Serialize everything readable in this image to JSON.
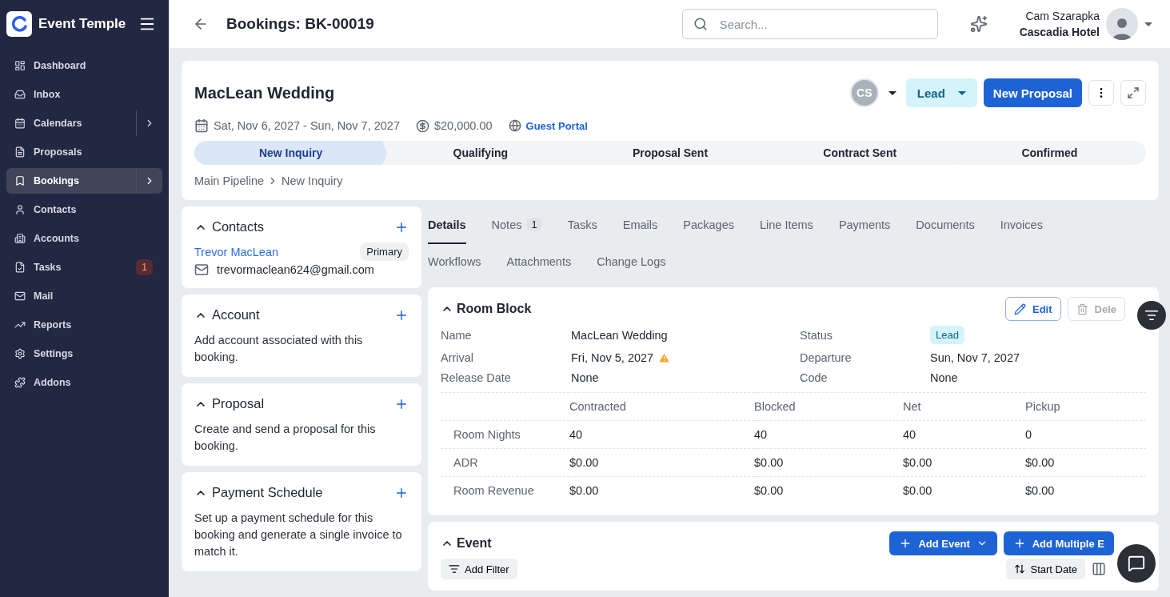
{
  "sidebar": {
    "brand": "Event Temple",
    "items": [
      {
        "label": "Dashboard",
        "selected": false
      },
      {
        "label": "Inbox",
        "selected": false
      },
      {
        "label": "Calendars",
        "selected": false,
        "submenu": true
      },
      {
        "label": "Proposals",
        "selected": false
      },
      {
        "label": "Bookings",
        "selected": true,
        "submenu": true
      },
      {
        "label": "Contacts",
        "selected": false
      },
      {
        "label": "Accounts",
        "selected": false
      },
      {
        "label": "Tasks",
        "selected": false,
        "badge": "1"
      },
      {
        "label": "Mail",
        "selected": false
      },
      {
        "label": "Reports",
        "selected": false
      },
      {
        "label": "Settings",
        "selected": false
      },
      {
        "label": "Addons",
        "selected": false
      }
    ]
  },
  "header": {
    "title": "Bookings: BK-00019",
    "search": {
      "placeholder": "Search..."
    },
    "user": {
      "name": "Cam Szarapka",
      "venue": "Cascadia Hotel"
    }
  },
  "booking": {
    "name": "MacLean Wedding",
    "owner_initials": "CS",
    "status": "Lead",
    "primary_action": "New Proposal",
    "dates": "Sat, Nov 6, 2027 - Sun, Nov 7, 2027",
    "amount": "$20,000.00",
    "portal_link": "Guest Portal",
    "stages": [
      {
        "label": "New Inquiry",
        "selected": true
      },
      {
        "label": "Qualifying",
        "selected": false
      },
      {
        "label": "Proposal Sent",
        "selected": false
      },
      {
        "label": "Contract Sent",
        "selected": false
      },
      {
        "label": "Confirmed",
        "selected": false
      }
    ],
    "breadcrumb": [
      "Main Pipeline",
      "New Inquiry"
    ]
  },
  "side_cards": [
    {
      "title": "Contacts",
      "contact": {
        "name": "Trevor MacLean",
        "role": "Primary",
        "email": "trevormaclean624@gmail.com"
      }
    },
    {
      "title": "Account",
      "text": "Add account associated with this booking."
    },
    {
      "title": "Proposal",
      "text": "Create and send a proposal for this booking."
    },
    {
      "title": "Payment Schedule",
      "text": "Set up a payment schedule for this booking and generate a single invoice to match it."
    }
  ],
  "tabs": [
    {
      "label": "Details",
      "selected": true
    },
    {
      "label": "Notes",
      "selected": false,
      "count": "1"
    },
    {
      "label": "Tasks",
      "selected": false
    },
    {
      "label": "Emails",
      "selected": false
    },
    {
      "label": "Packages",
      "selected": false
    },
    {
      "label": "Line Items",
      "selected": false
    },
    {
      "label": "Payments",
      "selected": false
    },
    {
      "label": "Documents",
      "selected": false
    },
    {
      "label": "Invoices",
      "selected": false
    },
    {
      "label": "Workflows",
      "selected": false
    },
    {
      "label": "Attachments",
      "selected": false
    },
    {
      "label": "Change Logs",
      "selected": false
    }
  ],
  "room_block": {
    "title": "Room Block",
    "edit": "Edit",
    "delete": "Dele",
    "fields": [
      {
        "label": "Name",
        "value": "MacLean Wedding"
      },
      {
        "label": "Status",
        "value": "Lead",
        "kind": "badge"
      },
      {
        "label": "Arrival",
        "value": "Fri, Nov 5, 2027",
        "kind": "warning"
      },
      {
        "label": "Departure",
        "value": "Sun, Nov 7, 2027"
      },
      {
        "label": "Release Date",
        "value": "None"
      },
      {
        "label": "Code",
        "value": "None"
      }
    ],
    "columns": [
      "Contracted",
      "Blocked",
      "Net",
      "Pickup"
    ],
    "rows": [
      {
        "label": "Room Nights",
        "values": [
          "40",
          "40",
          "40",
          "0"
        ]
      },
      {
        "label": "ADR",
        "values": [
          "$0.00",
          "$0.00",
          "$0.00",
          "$0.00"
        ]
      },
      {
        "label": "Room Revenue",
        "values": [
          "$0.00",
          "$0.00",
          "$0.00",
          "$0.00"
        ]
      }
    ]
  },
  "event": {
    "title": "Event",
    "add": "Add Event",
    "add_multiple": "Add Multiple E",
    "filter": "Add Filter",
    "sort": "Start Date"
  }
}
